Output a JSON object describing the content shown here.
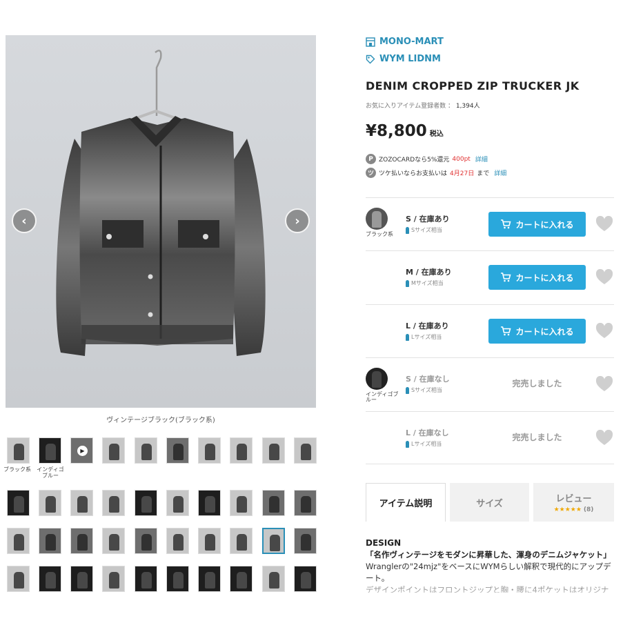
{
  "caption": "ヴィンテージブラック(ブラック系)",
  "nav": {
    "prev": "‹",
    "next": "›"
  },
  "thumb_labels": {
    "black": "ブラック系",
    "indigo": "インディゴブルー"
  },
  "shop": {
    "name": "MONO-MART",
    "brand": "WYM LIDNM"
  },
  "product": {
    "title": "DENIM CROPPED ZIP TRUCKER JK",
    "fav_label": "お気に入りアイテム登録者数 ：",
    "fav_count": "1,394人",
    "price": "¥8,800",
    "tax": "税込"
  },
  "promos": [
    {
      "icon": "P",
      "pre": "ZOZOCARDなら5%還元",
      "hl": "400pt",
      "post": "",
      "link": "詳細"
    },
    {
      "icon": "ツ",
      "pre": "ツケ払いならお支払いは",
      "hl": "4月27日",
      "post": "まで",
      "link": "詳細"
    }
  ],
  "skus": [
    {
      "swatch_label": "ブラック系",
      "size": "S / 在庫あり",
      "fit": "Sサイズ相当",
      "action": "カートに入れる"
    },
    {
      "swatch_label": "",
      "size": "M / 在庫あり",
      "fit": "Mサイズ相当",
      "action": "カートに入れる"
    },
    {
      "swatch_label": "",
      "size": "L / 在庫あり",
      "fit": "Lサイズ相当",
      "action": "カートに入れる"
    },
    {
      "swatch_label": "インディゴブルー",
      "size": "S / 在庫なし",
      "fit": "Sサイズ相当",
      "action": "完売しました"
    },
    {
      "swatch_label": "",
      "size": "L / 在庫なし",
      "fit": "Lサイズ相当",
      "action": "完売しました"
    }
  ],
  "tabs": {
    "desc": "アイテム説明",
    "size": "サイズ",
    "review": "レビュー",
    "stars": "★★★★★",
    "review_count": "(8)"
  },
  "description": {
    "heading": "DESIGN",
    "lead": "「名作ヴィンテージをモダンに昇華した、渾身のデニムジャケット」",
    "body": "Wranglerの\"24mjz\"をベースにWYMらしい解釈で現代的にアップデート。",
    "cut": "デザインポイントはフロントジップと胸・腰に4ポケットはオリジナ"
  },
  "colors": {
    "accent": "#2a8fb7",
    "cart": "#2aa8dc",
    "sale_red": "#e03030",
    "star": "#f0a800"
  },
  "icons": {
    "shop": "store-icon",
    "brand": "tag-icon",
    "cart": "cart-icon",
    "heart": "heart-icon",
    "figure": "person-icon"
  }
}
